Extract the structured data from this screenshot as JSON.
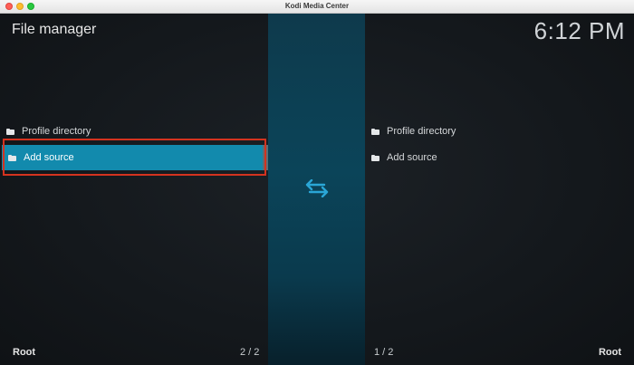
{
  "window": {
    "title": "Kodi Media Center"
  },
  "header": {
    "title": "File manager",
    "clock": "6:12 PM"
  },
  "left_pane": {
    "items": [
      {
        "label": "Profile directory",
        "icon": "folder-icon",
        "selected": false
      },
      {
        "label": "Add source",
        "icon": "folder-icon",
        "selected": true
      }
    ],
    "footer_label": "Root",
    "page_count": "2 / 2"
  },
  "right_pane": {
    "items": [
      {
        "label": "Profile directory",
        "icon": "folder-icon"
      },
      {
        "label": "Add source",
        "icon": "folder-icon"
      }
    ],
    "footer_label": "Root",
    "page_count": "1 / 2"
  },
  "center": {
    "icon": "swap-arrows-icon",
    "accent_color": "#2aa6d6"
  },
  "colors": {
    "selection": "#128aad",
    "annotation_box": "#d4331f"
  }
}
